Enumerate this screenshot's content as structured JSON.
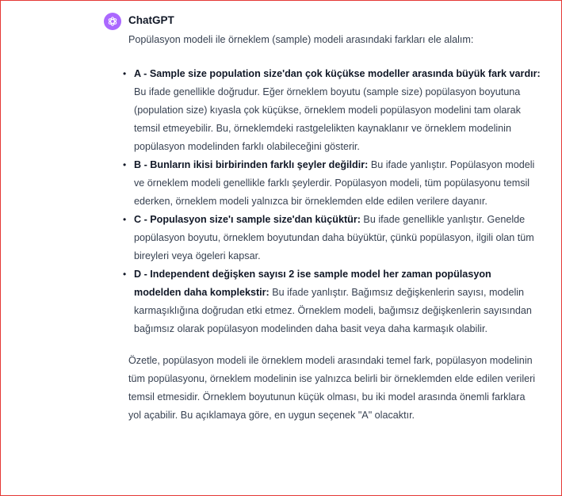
{
  "chat": {
    "sender": "ChatGPT",
    "avatar_icon": "openai-logo-icon",
    "avatar_color": "#ab68ff",
    "intro": "Popülasyon modeli ile örneklem (sample) modeli arasındaki farkları ele alalım:",
    "items": [
      {
        "bold": "A - Sample size population size'dan çok küçükse modeller arasında büyük fark vardır:",
        "text": " Bu ifade genellikle doğrudur. Eğer örneklem boyutu (sample size) popülasyon boyutuna (population size) kıyasla çok küçükse, örneklem modeli popülasyon modelini tam olarak temsil etmeyebilir. Bu, örneklemdeki rastgelelikten kaynaklanır ve örneklem modelinin popülasyon modelinden farklı olabileceğini gösterir."
      },
      {
        "bold": "B - Bunların ikisi birbirinden farklı şeyler değildir:",
        "text": " Bu ifade yanlıştır. Popülasyon modeli ve örneklem modeli genellikle farklı şeylerdir. Popülasyon modeli, tüm popülasyonu temsil ederken, örneklem modeli yalnızca bir örneklemden elde edilen verilere dayanır."
      },
      {
        "bold": "C - Populasyon size'ı sample size'dan küçüktür:",
        "text": " Bu ifade genellikle yanlıştır. Genelde popülasyon boyutu, örneklem boyutundan daha büyüktür, çünkü popülasyon, ilgili olan tüm bireyleri veya ögeleri kapsar."
      },
      {
        "bold": "D - Independent değişken sayısı 2 ise sample model her zaman popülasyon modelden daha komplekstir:",
        "text": " Bu ifade yanlıştır. Bağımsız değişkenlerin sayısı, modelin karmaşıklığına doğrudan etki etmez. Örneklem modeli, bağımsız değişkenlerin sayısından bağımsız olarak popülasyon modelinden daha basit veya daha karmaşık olabilir."
      }
    ],
    "summary": "Özetle, popülasyon modeli ile örneklem modeli arasındaki temel fark, popülasyon modelinin tüm popülasyonu, örneklem modelinin ise yalnızca belirli bir örneklemden elde edilen verileri temsil etmesidir. Örneklem boyutunun küçük olması, bu iki model arasında önemli farklara yol açabilir. Bu açıklamaya göre, en uygun seçenek \"A\" olacaktır."
  }
}
